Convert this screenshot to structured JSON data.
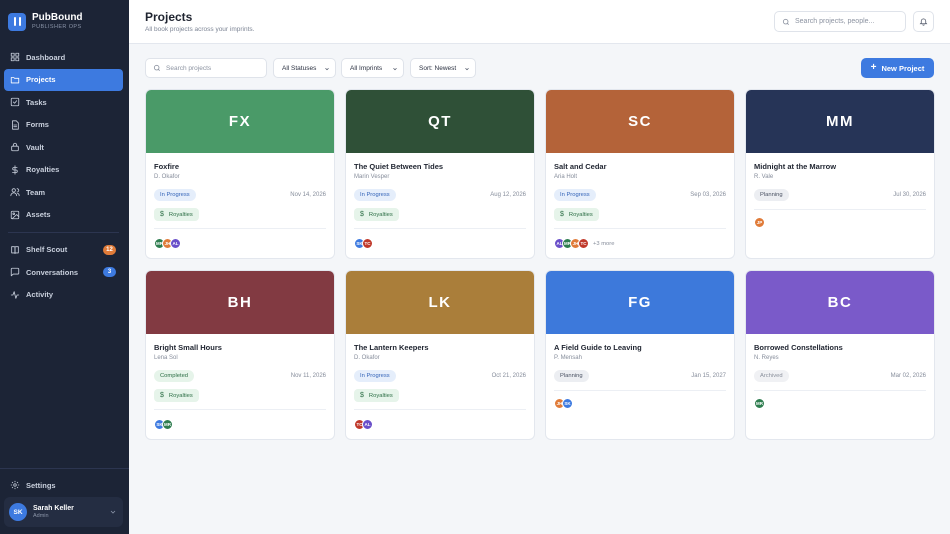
{
  "brand": {
    "name": "PubBound",
    "sub": "PUBLISHER OPS"
  },
  "nav": [
    {
      "label": "Dashboard",
      "icon": "grid-icon",
      "active": false
    },
    {
      "label": "Projects",
      "icon": "folder-icon",
      "active": true
    },
    {
      "label": "Tasks",
      "icon": "checkbox-icon",
      "active": false
    },
    {
      "label": "Forms",
      "icon": "document-icon",
      "active": false
    },
    {
      "label": "Vault",
      "icon": "vault-icon",
      "active": false
    },
    {
      "label": "Royalties",
      "icon": "dollar-icon",
      "active": false
    },
    {
      "label": "Team",
      "icon": "users-icon",
      "active": false
    },
    {
      "label": "Assets",
      "icon": "image-icon",
      "active": false
    }
  ],
  "nav2": [
    {
      "label": "Shelf Scout",
      "icon": "book-icon",
      "badge": "12",
      "badge_color": "#e07b39"
    },
    {
      "label": "Conversations",
      "icon": "chat-icon",
      "badge": "3",
      "badge_color": "#3d7ae0"
    },
    {
      "label": "Activity",
      "icon": "activity-icon",
      "badge": "",
      "badge_color": ""
    }
  ],
  "settings_label": "Settings",
  "user": {
    "initials": "SK",
    "name": "Sarah Keller",
    "role": "Admin"
  },
  "header": {
    "title": "Projects",
    "subtitle": "All book projects across your imprints."
  },
  "top_search": {
    "placeholder": "Search projects, people..."
  },
  "filters": {
    "search_placeholder": "Search projects",
    "status": "All Statuses",
    "imprint": "All Imprints",
    "sort": "Sort: Newest"
  },
  "new_button": "New Project",
  "royalties_label": "Royalties",
  "projects": [
    {
      "initials": "FX",
      "color": "#4a9a68",
      "title": "Foxfire",
      "author": "D. Okafor",
      "status": "In Progress",
      "date": "Nov 14, 2026",
      "royalties": true,
      "avatars": [
        {
          "i": "MR",
          "c": "#2e7d4f"
        },
        {
          "i": "JH",
          "c": "#e07b39"
        },
        {
          "i": "AL",
          "c": "#6a4fc9"
        }
      ],
      "more": ""
    },
    {
      "initials": "QT",
      "color": "#2f5037",
      "title": "The Quiet Between Tides",
      "author": "Marin Vesper",
      "status": "In Progress",
      "date": "Aug 12, 2026",
      "royalties": true,
      "avatars": [
        {
          "i": "SK",
          "c": "#3d7ae0"
        },
        {
          "i": "TC",
          "c": "#c0392b"
        }
      ],
      "more": ""
    },
    {
      "initials": "SC",
      "color": "#b46339",
      "title": "Salt and Cedar",
      "author": "Aria Holt",
      "status": "In Progress",
      "date": "Sep 03, 2026",
      "royalties": true,
      "avatars": [
        {
          "i": "AL",
          "c": "#6a4fc9"
        },
        {
          "i": "MR",
          "c": "#2e7d4f"
        },
        {
          "i": "JH",
          "c": "#e07b39"
        },
        {
          "i": "TC",
          "c": "#c0392b"
        }
      ],
      "more": "+3 more"
    },
    {
      "initials": "MM",
      "color": "#263457",
      "title": "Midnight at the Marrow",
      "author": "R. Vale",
      "status": "Planning",
      "date": "Jul 30, 2026",
      "royalties": false,
      "avatars": [
        {
          "i": "JP",
          "c": "#e07b39"
        }
      ],
      "more": ""
    },
    {
      "initials": "BH",
      "color": "#823a42",
      "title": "Bright Small Hours",
      "author": "Lena Sol",
      "status": "Completed",
      "date": "Nov 11, 2026",
      "royalties": true,
      "avatars": [
        {
          "i": "SK",
          "c": "#3d7ae0"
        },
        {
          "i": "MR",
          "c": "#2e7d4f"
        }
      ],
      "more": ""
    },
    {
      "initials": "LK",
      "color": "#aa7e3a",
      "title": "The Lantern Keepers",
      "author": "D. Okafor",
      "status": "In Progress",
      "date": "Oct 21, 2026",
      "royalties": true,
      "avatars": [
        {
          "i": "TC",
          "c": "#c0392b"
        },
        {
          "i": "AL",
          "c": "#6a4fc9"
        }
      ],
      "more": ""
    },
    {
      "initials": "FG",
      "color": "#3d79db",
      "title": "A Field Guide to Leaving",
      "author": "P. Mensah",
      "status": "Planning",
      "date": "Jan 15, 2027",
      "royalties": false,
      "avatars": [
        {
          "i": "JH",
          "c": "#e07b39"
        },
        {
          "i": "SK",
          "c": "#3d7ae0"
        }
      ],
      "more": ""
    },
    {
      "initials": "BC",
      "color": "#7a5ac9",
      "title": "Borrowed Constellations",
      "author": "N. Reyes",
      "status": "Archived",
      "date": "Mar 02, 2026",
      "royalties": false,
      "avatars": [
        {
          "i": "MR",
          "c": "#2e7d4f"
        }
      ],
      "more": ""
    }
  ]
}
